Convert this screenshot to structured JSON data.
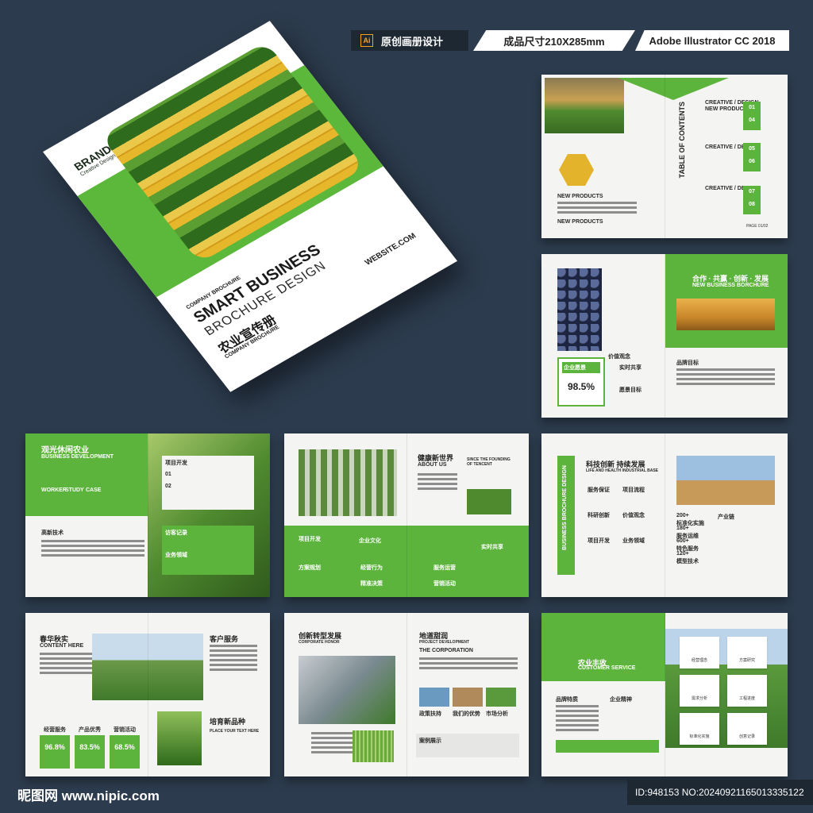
{
  "badges": {
    "software_label": "原创画册设计",
    "ai_icon": "Ai",
    "size_label": "成品尺寸210X285mm",
    "app_label": "Adobe Illustrator CC 2018"
  },
  "cover": {
    "brand": "BRAND",
    "brand_sub": "Creative Design",
    "line1": "COMPANY BROCHURE",
    "line2": "SMART BUSINESS",
    "line3": "BROCHURE DESIGN",
    "line4": "农业宣传册",
    "line5": "COMPANY BROCHURE",
    "website": "WEBSITE.COM"
  },
  "p1": {
    "contents": "TABLE OF CONTENTS",
    "sec": "CREATIVE / DESIGN",
    "sec2": "NEW PRODUCTS",
    "nums": [
      "01",
      "04",
      "05",
      "06",
      "07",
      "08"
    ],
    "newp": "NEW PRODUCTS",
    "page": "PAGE 01/02"
  },
  "p2": {
    "title": "合作 · 共赢 · 创新 · 发展",
    "sub": "NEW BUSINESS BORCHURE",
    "culture": "企业愿景",
    "pct": "98.5%",
    "value": "价值观念",
    "share": "实时共享",
    "goal": "品牌目标",
    "vision": "愿景目标"
  },
  "p3": {
    "title": "观光休闲农业",
    "sub": "BUSINESS DEVELOPMENT",
    "tabs": [
      "WORKER",
      "STUDY",
      "CASE"
    ],
    "proj": "项目开发",
    "n1": "01",
    "n2": "02",
    "visit": "访客记录",
    "svc": "业务领域",
    "hi": "高新技术"
  },
  "p4": {
    "title": "健康新世界",
    "about": "ABOUT US",
    "since": "SINCE THE FOUNDING OF TENCENT",
    "proj": "项目开发",
    "culture": "企业文化",
    "plan": "方案规划",
    "items": [
      "经营行为",
      "精准决策",
      "服务运营",
      "营销活动"
    ],
    "share": "实时共享"
  },
  "p5": {
    "side": "BUSINESS BROCHURE DESIGN",
    "title": "科技创新 持续发展",
    "sub": "LIFE AND HEALTH INDUSTRIAL BASE",
    "items": [
      "服务保证",
      "项目流程",
      "科研创新",
      "价值观念",
      "项目开发",
      "业务领域"
    ],
    "chain": "产业链",
    "stats": [
      "200+",
      "标准化实施",
      "180+",
      "服务运维",
      "600+",
      "特色服务",
      "120+",
      "模型技术"
    ]
  },
  "p6": {
    "title": "春华秋实",
    "sub": "CONTENT HERE",
    "svc": "客户服务",
    "labels": [
      "经营服务",
      "产品优秀",
      "营销活动"
    ],
    "pcts": [
      "96.8%",
      "83.5%",
      "68.5%"
    ],
    "breed": "培育新品种",
    "place": "PLACE YOUR TEXT HERE"
  },
  "p7": {
    "title": "创新转型发展",
    "sub": "CORPORATE HONOR",
    "right": "地道甜润",
    "dev": "PROJECT DEVELOPMENT",
    "corp": "THE CORPORATION",
    "caps": [
      "政策扶持",
      "我们的优势",
      "市场分析"
    ],
    "case": "案例展示"
  },
  "p8": {
    "title": "农业丰收",
    "sub": "CUSTOMER SERVICE",
    "left": [
      "品牌特质",
      "企业精神"
    ],
    "tiles": [
      "经营理念",
      "方案研究",
      "需求分析",
      "工程进度",
      "标准化实施",
      "创意记录"
    ]
  },
  "watermark": {
    "logo": "昵图网 www.nipic.com",
    "id": "ID:948153 NO:20240921165013335122"
  }
}
